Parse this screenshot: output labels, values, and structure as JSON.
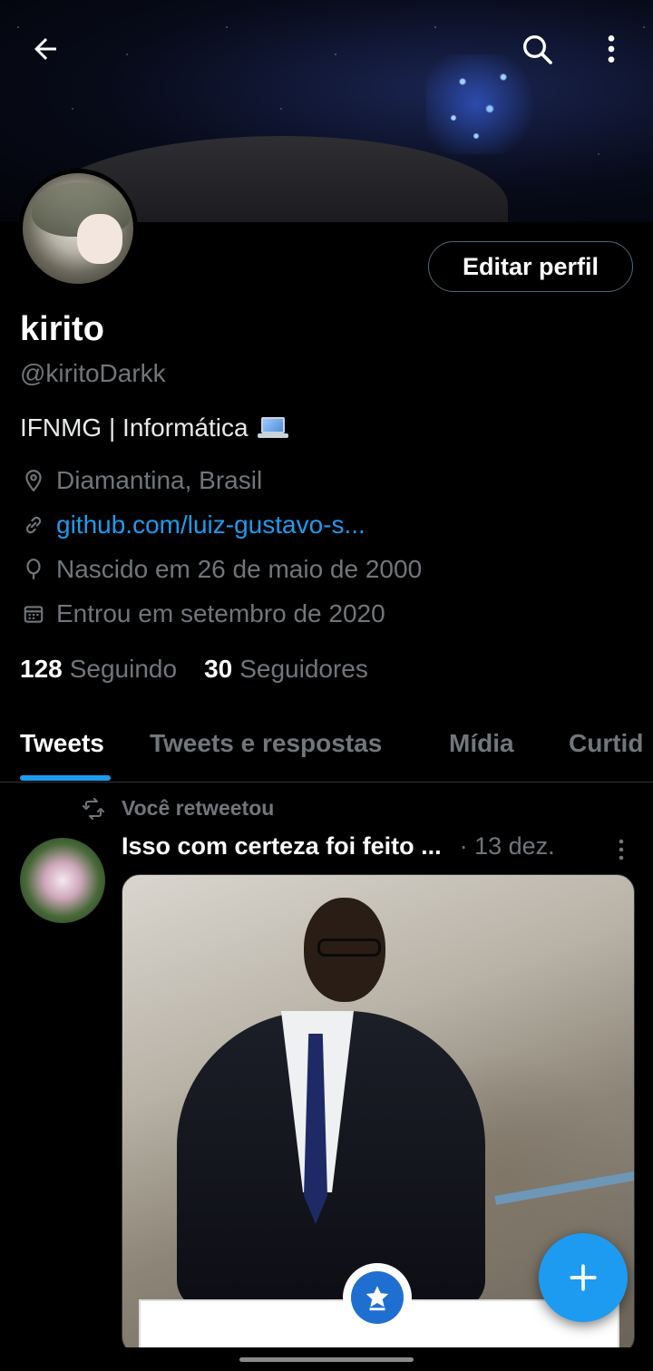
{
  "profile": {
    "name": "kirito",
    "handle": "@kiritoDarkk",
    "bio": "IFNMG | Informática",
    "location": "Diamantina, Brasil",
    "website": "github.com/luiz-gustavo-s...",
    "birth": "Nascido em 26 de maio de 2000",
    "joined": "Entrou em setembro de 2020",
    "following_count": "128",
    "following_label": "Seguindo",
    "followers_count": "30",
    "followers_label": "Seguidores",
    "edit_button": "Editar perfil"
  },
  "tabs": [
    "Tweets",
    "Tweets e respostas",
    "Mídia",
    "Curtid"
  ],
  "tweet": {
    "retweet_label": "Você retweetou",
    "text": "Isso com certeza foi feito ...",
    "time": "· 13 dez."
  },
  "icons": {
    "back": "arrow-left-icon",
    "search": "search-icon",
    "more": "more-vertical-icon",
    "location": "location-pin-icon",
    "link": "link-icon",
    "birth": "balloon-icon",
    "join": "calendar-icon",
    "retweet": "retweet-icon",
    "compose": "plus-icon"
  },
  "colors": {
    "accent": "#1d9bf0",
    "background": "#000000",
    "secondary_text": "#71767b"
  }
}
